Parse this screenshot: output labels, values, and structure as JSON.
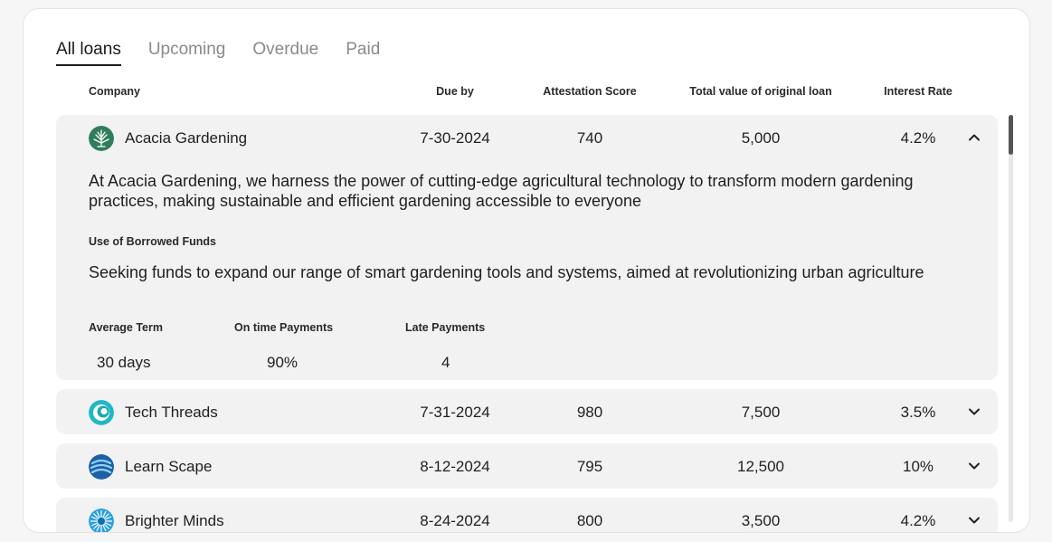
{
  "tabs": [
    {
      "label": "All loans",
      "active": true
    },
    {
      "label": "Upcoming",
      "active": false
    },
    {
      "label": "Overdue",
      "active": false
    },
    {
      "label": "Paid",
      "active": false
    }
  ],
  "headers": {
    "company": "Company",
    "due_by": "Due by",
    "attestation_score": "Attestation Score",
    "total_value": "Total value of original loan",
    "interest_rate": "Interest Rate"
  },
  "loans": [
    {
      "company": "Acacia Gardening",
      "logo_icon": "tree-icon",
      "due_by": "7-30-2024",
      "score": "740",
      "total": "5,000",
      "rate": "4.2%",
      "expanded": true,
      "description": "At Acacia Gardening, we harness the power of cutting-edge agricultural technology to transform modern gardening practices, making sustainable and efficient gardening accessible to everyone",
      "use_of_funds_label": "Use of Borrowed Funds",
      "use_of_funds": "Seeking funds to expand our range of smart gardening tools and systems, aimed at revolutionizing urban agriculture",
      "stats": {
        "avg_term_label": "Average Term",
        "avg_term": "30 days",
        "on_time_label": "On time Payments",
        "on_time": "90%",
        "late_label": "Late Payments",
        "late": "4"
      }
    },
    {
      "company": "Tech Threads",
      "logo_icon": "swirl-icon",
      "due_by": "7-31-2024",
      "score": "980",
      "total": "7,500",
      "rate": "3.5%",
      "expanded": false
    },
    {
      "company": "Learn Scape",
      "logo_icon": "globe-stripes-icon",
      "due_by": "8-12-2024",
      "score": "795",
      "total": "12,500",
      "rate": "10%",
      "expanded": false
    },
    {
      "company": "Brighter Minds",
      "logo_icon": "sunburst-icon",
      "due_by": "8-24-2024",
      "score": "800",
      "total": "3,500",
      "rate": "4.2%",
      "expanded": false
    }
  ],
  "colors": {
    "row_bg": "#f2f2f2",
    "acacia_green": "#2f7d5b",
    "tech_teal": "#1fb8c6",
    "learn_blue": "#1d5fa8",
    "brighter_blue": "#2aa0e0"
  }
}
